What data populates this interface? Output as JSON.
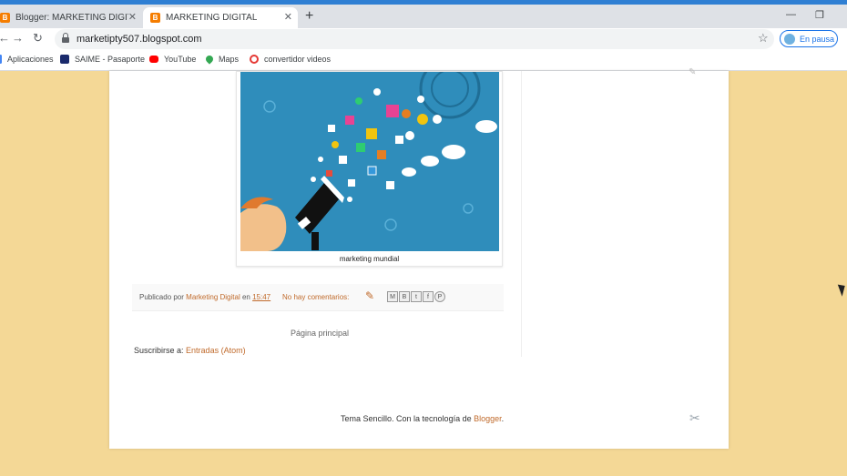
{
  "browser": {
    "tabs": [
      {
        "title": "Blogger: MARKETING DIGITAL - T",
        "favicon": "B"
      },
      {
        "title": "MARKETING DIGITAL",
        "favicon": "B"
      }
    ],
    "url": "marketipty507.blogspot.com",
    "profile_label": "En pausa",
    "bookmarks": [
      {
        "label": "Aplicaciones",
        "icon": "apps-grid-icon",
        "color": "#4285f4"
      },
      {
        "label": "SAIME - Pasaporte",
        "icon": "saime-icon",
        "color": "#1a2a6c"
      },
      {
        "label": "YouTube",
        "icon": "youtube-icon",
        "color": "#ff0000"
      },
      {
        "label": "Maps",
        "icon": "maps-pin-icon",
        "color": "#34a853"
      },
      {
        "label": "convertidor videos",
        "icon": "converter-icon",
        "color": "#e53935"
      }
    ]
  },
  "post": {
    "caption": "marketing mundial",
    "footer": {
      "published_by": "Publicado por",
      "author": "Marketing Digital",
      "at": "en",
      "time": "15:47",
      "comments": "No hay comentarios:"
    },
    "share_buttons": [
      "M",
      "B",
      "t",
      "f",
      "P"
    ]
  },
  "blog": {
    "home_link": "Página principal",
    "subscribe_label": "Suscribirse a:",
    "subscribe_link": "Entradas (Atom)",
    "attribution_text": "Tema Sencillo. Con la tecnología de",
    "attribution_link": "Blogger"
  },
  "colors": {
    "page_background": "#f4d896",
    "link": "#c06a2b",
    "image_blue": "#2f8dbb",
    "chrome_blue": "#1a73e8"
  }
}
